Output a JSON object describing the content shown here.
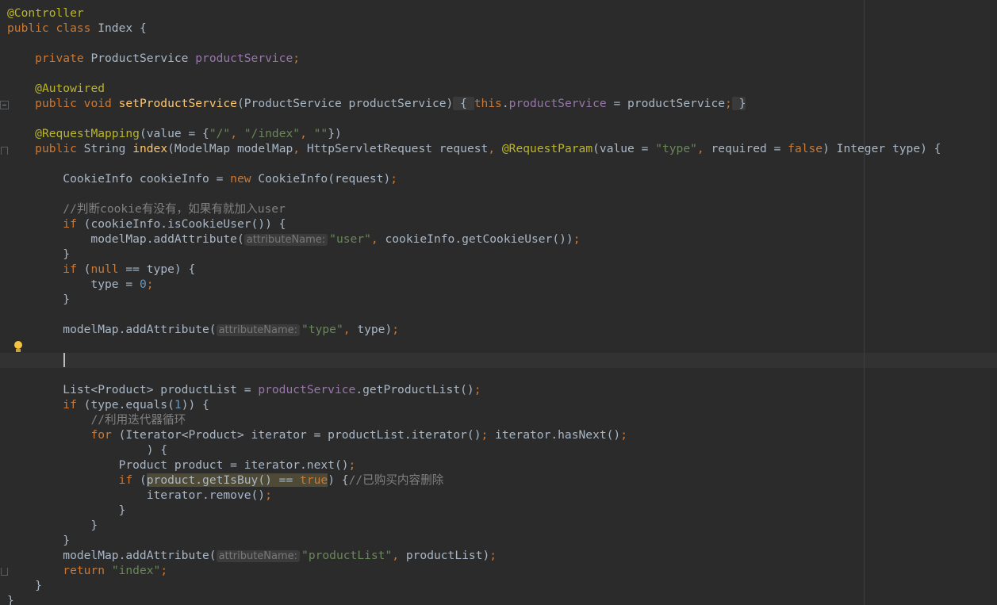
{
  "editor": {
    "colors": {
      "background": "#2b2b2b",
      "keyword": "#cc7832",
      "annotation": "#bbb529",
      "field": "#9876aa",
      "string": "#6a8759",
      "number": "#6897bb",
      "method_declaration": "#ffc66d",
      "comment": "#808080",
      "plain": "#a9b7c6"
    },
    "gutter_icons": [
      "fold-icon",
      "lightbulb-icon"
    ],
    "lines": [
      {
        "tokens": [
          [
            "ann",
            "@Controller"
          ]
        ]
      },
      {
        "tokens": [
          [
            "kw",
            "public class "
          ],
          [
            "p",
            "Index {"
          ]
        ]
      },
      {
        "tokens": []
      },
      {
        "tokens": [
          [
            "p",
            "    "
          ],
          [
            "kw",
            "private "
          ],
          [
            "p",
            "ProductService "
          ],
          [
            "fld",
            "productService"
          ],
          [
            "kw",
            ";"
          ]
        ]
      },
      {
        "tokens": []
      },
      {
        "tokens": [
          [
            "p",
            "    "
          ],
          [
            "ann",
            "@Autowired"
          ]
        ]
      },
      {
        "tokens": [
          [
            "p",
            "    "
          ],
          [
            "kw",
            "public void "
          ],
          [
            "fn",
            "setProductService"
          ],
          [
            "p",
            "(ProductService productService)"
          ],
          [
            "fb",
            " { "
          ],
          [
            "kw",
            "this"
          ],
          [
            "p",
            "."
          ],
          [
            "fld",
            "productService"
          ],
          [
            "p",
            " = productService"
          ],
          [
            "kw",
            ";"
          ],
          [
            "fb",
            " }"
          ]
        ]
      },
      {
        "tokens": []
      },
      {
        "tokens": [
          [
            "p",
            "    "
          ],
          [
            "ann",
            "@RequestMapping"
          ],
          [
            "p",
            "(value = {"
          ],
          [
            "str",
            "\"/\""
          ],
          [
            "kw",
            ", "
          ],
          [
            "str",
            "\"/index\""
          ],
          [
            "kw",
            ", "
          ],
          [
            "str",
            "\"\""
          ],
          [
            "p",
            "})"
          ]
        ]
      },
      {
        "tokens": [
          [
            "p",
            "    "
          ],
          [
            "kw",
            "public "
          ],
          [
            "p",
            "String "
          ],
          [
            "fn",
            "index"
          ],
          [
            "p",
            "(ModelMap modelMap"
          ],
          [
            "kw",
            ", "
          ],
          [
            "p",
            "HttpServletRequest request"
          ],
          [
            "kw",
            ", "
          ],
          [
            "ann",
            "@RequestParam"
          ],
          [
            "p",
            "(value = "
          ],
          [
            "str",
            "\"type\""
          ],
          [
            "kw",
            ", "
          ],
          [
            "p",
            "required = "
          ],
          [
            "kw",
            "false"
          ],
          [
            "p",
            ") Integer type) {"
          ]
        ]
      },
      {
        "tokens": []
      },
      {
        "tokens": [
          [
            "p",
            "        CookieInfo cookieInfo = "
          ],
          [
            "kw",
            "new "
          ],
          [
            "p",
            "CookieInfo(request)"
          ],
          [
            "kw",
            ";"
          ]
        ]
      },
      {
        "tokens": []
      },
      {
        "tokens": [
          [
            "p",
            "        "
          ],
          [
            "cmt",
            "//判断cookie有没有，如果有就加入user"
          ]
        ]
      },
      {
        "tokens": [
          [
            "p",
            "        "
          ],
          [
            "kw",
            "if "
          ],
          [
            "p",
            "(cookieInfo.isCookieUser()) {"
          ]
        ]
      },
      {
        "tokens": [
          [
            "p",
            "            modelMap.addAttribute("
          ],
          [
            "hint",
            "attributeName:"
          ],
          [
            "str",
            "\"user\""
          ],
          [
            "kw",
            ", "
          ],
          [
            "p",
            "cookieInfo.getCookieUser())"
          ],
          [
            "kw",
            ";"
          ]
        ]
      },
      {
        "tokens": [
          [
            "p",
            "        }"
          ]
        ]
      },
      {
        "tokens": [
          [
            "p",
            "        "
          ],
          [
            "kw",
            "if "
          ],
          [
            "p",
            "("
          ],
          [
            "kw",
            "null "
          ],
          [
            "p",
            "== type) {"
          ]
        ]
      },
      {
        "tokens": [
          [
            "p",
            "            type = "
          ],
          [
            "num",
            "0"
          ],
          [
            "kw",
            ";"
          ]
        ]
      },
      {
        "tokens": [
          [
            "p",
            "        }"
          ]
        ]
      },
      {
        "tokens": []
      },
      {
        "tokens": [
          [
            "p",
            "        modelMap.addAttribute("
          ],
          [
            "hint",
            "attributeName:"
          ],
          [
            "str",
            "\"type\""
          ],
          [
            "kw",
            ", "
          ],
          [
            "p",
            "type)"
          ],
          [
            "kw",
            ";"
          ]
        ]
      },
      {
        "tokens": []
      },
      {
        "tokens": []
      },
      {
        "tokens": []
      },
      {
        "tokens": [
          [
            "p",
            "        List<Product> productList = "
          ],
          [
            "fld",
            "productService"
          ],
          [
            "p",
            ".getProductList()"
          ],
          [
            "kw",
            ";"
          ]
        ]
      },
      {
        "tokens": [
          [
            "p",
            "        "
          ],
          [
            "kw",
            "if "
          ],
          [
            "p",
            "(type.equals("
          ],
          [
            "num",
            "1"
          ],
          [
            "p",
            ")) {"
          ]
        ]
      },
      {
        "tokens": [
          [
            "p",
            "            "
          ],
          [
            "cmt",
            "//利用迭代器循环"
          ]
        ]
      },
      {
        "tokens": [
          [
            "p",
            "            "
          ],
          [
            "kw",
            "for "
          ],
          [
            "p",
            "(Iterator<Product> iterator = productList.iterator()"
          ],
          [
            "kw",
            "; "
          ],
          [
            "p",
            "iterator.hasNext()"
          ],
          [
            "kw",
            ";"
          ]
        ]
      },
      {
        "tokens": [
          [
            "p",
            "                    ) {"
          ]
        ]
      },
      {
        "tokens": [
          [
            "p",
            "                Product product = iterator.next()"
          ],
          [
            "kw",
            ";"
          ]
        ]
      },
      {
        "tokens": [
          [
            "p",
            "                "
          ],
          [
            "kw",
            "if "
          ],
          [
            "p",
            "("
          ],
          [
            "hl",
            "product.getIsBuy() == "
          ],
          [
            "hlkw",
            "true"
          ],
          [
            "p",
            ") {"
          ],
          [
            "cmt",
            "//已购买内容删除"
          ]
        ]
      },
      {
        "tokens": [
          [
            "p",
            "                    iterator.remove()"
          ],
          [
            "kw",
            ";"
          ]
        ]
      },
      {
        "tokens": [
          [
            "p",
            "                }"
          ]
        ]
      },
      {
        "tokens": [
          [
            "p",
            "            }"
          ]
        ]
      },
      {
        "tokens": [
          [
            "p",
            "        }"
          ]
        ]
      },
      {
        "tokens": [
          [
            "p",
            "        modelMap.addAttribute("
          ],
          [
            "hint",
            "attributeName:"
          ],
          [
            "str",
            "\"productList\""
          ],
          [
            "kw",
            ", "
          ],
          [
            "p",
            "productList)"
          ],
          [
            "kw",
            ";"
          ]
        ]
      },
      {
        "tokens": [
          [
            "p",
            "        "
          ],
          [
            "kw",
            "return "
          ],
          [
            "str",
            "\"index\""
          ],
          [
            "kw",
            ";"
          ]
        ]
      },
      {
        "tokens": [
          [
            "p",
            "    }"
          ]
        ]
      },
      {
        "tokens": [
          [
            "p",
            "}"
          ]
        ]
      }
    ]
  }
}
